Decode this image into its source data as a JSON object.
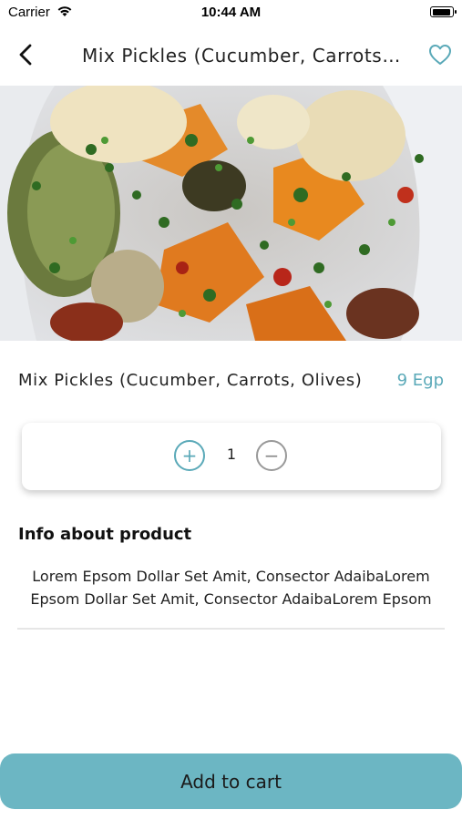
{
  "status_bar": {
    "carrier": "Carrier",
    "time": "10:44 AM"
  },
  "nav": {
    "title": "Mix Pickles (Cucumber, Carrots,...",
    "back_icon": "chevron-left-icon",
    "favorite_icon": "heart-outline-icon"
  },
  "product": {
    "name": "Mix Pickles (Cucumber, Carrots, Olives)",
    "price": "9 Egp"
  },
  "quantity": {
    "value": "1",
    "increase_symbol": "+",
    "decrease_symbol": "−"
  },
  "info": {
    "heading": "Info about product",
    "text": "Lorem Epsom Dollar Set Amit, Consector AdaibaLorem Epsom Dollar Set Amit, Consector AdaibaLorem Epsom"
  },
  "actions": {
    "add_to_cart": "Add to cart"
  },
  "colors": {
    "accent": "#5aa9b8",
    "button": "#6cb6c3"
  }
}
